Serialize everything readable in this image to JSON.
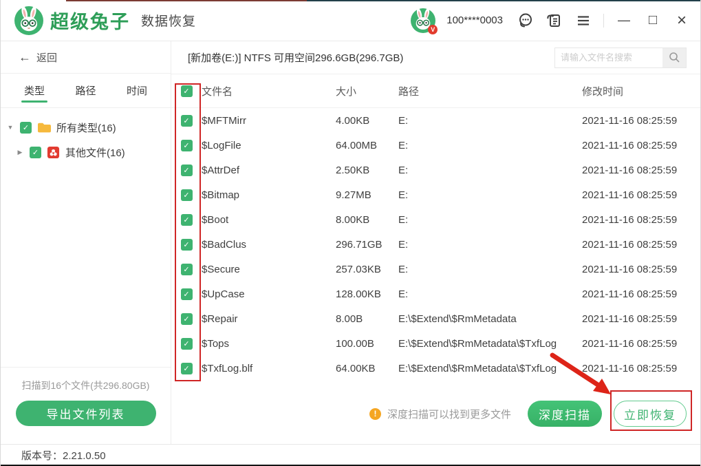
{
  "titlebar": {
    "brand": "超级兔子",
    "product": "数据恢复",
    "account": "100****0003"
  },
  "icons": {
    "back_arrow": "←",
    "caret_down": "▼",
    "caret_right": "▶",
    "check": "✓",
    "warning": "!",
    "minimize": "—",
    "maximize": "□",
    "close": "×",
    "badge_v": "V"
  },
  "sidebar": {
    "back_label": "返回",
    "tabs": [
      {
        "label": "类型",
        "active": true
      },
      {
        "label": "路径",
        "active": false
      },
      {
        "label": "时间",
        "active": false
      }
    ],
    "tree": [
      {
        "label": "所有类型(16)",
        "icon": "folder-icon",
        "checked": true,
        "expanded": true
      },
      {
        "label": "其他文件(16)",
        "icon": "other-file-icon",
        "checked": true,
        "expanded": false
      }
    ],
    "scan_summary": "扫描到16个文件(共296.80GB)",
    "export_button": "导出文件列表"
  },
  "main": {
    "volume_info": "[新加卷(E:)] NTFS 可用空间296.6GB(296.7GB)",
    "search_placeholder": "请输入文件名搜索",
    "table": {
      "columns": [
        "文件名",
        "大小",
        "路径",
        "修改时间"
      ],
      "header_checked": true,
      "rows": [
        {
          "checked": true,
          "name": "$MFTMirr",
          "size": "4.00KB",
          "path": "E:",
          "time": "2021-11-16 08:25:59"
        },
        {
          "checked": true,
          "name": "$LogFile",
          "size": "64.00MB",
          "path": "E:",
          "time": "2021-11-16 08:25:59"
        },
        {
          "checked": true,
          "name": "$AttrDef",
          "size": "2.50KB",
          "path": "E:",
          "time": "2021-11-16 08:25:59"
        },
        {
          "checked": true,
          "name": "$Bitmap",
          "size": "9.27MB",
          "path": "E:",
          "time": "2021-11-16 08:25:59"
        },
        {
          "checked": true,
          "name": "$Boot",
          "size": "8.00KB",
          "path": "E:",
          "time": "2021-11-16 08:25:59"
        },
        {
          "checked": true,
          "name": "$BadClus",
          "size": "296.71GB",
          "path": "E:",
          "time": "2021-11-16 08:25:59"
        },
        {
          "checked": true,
          "name": "$Secure",
          "size": "257.03KB",
          "path": "E:",
          "time": "2021-11-16 08:25:59"
        },
        {
          "checked": true,
          "name": "$UpCase",
          "size": "128.00KB",
          "path": "E:",
          "time": "2021-11-16 08:25:59"
        },
        {
          "checked": true,
          "name": "$Repair",
          "size": "8.00B",
          "path": "E:\\$Extend\\$RmMetadata",
          "time": "2021-11-16 08:25:59"
        },
        {
          "checked": true,
          "name": "$Tops",
          "size": "100.00B",
          "path": "E:\\$Extend\\$RmMetadata\\$TxfLog",
          "time": "2021-11-16 08:25:59"
        },
        {
          "checked": true,
          "name": "$TxfLog.blf",
          "size": "64.00KB",
          "path": "E:\\$Extend\\$RmMetadata\\$TxfLog",
          "time": "2021-11-16 08:25:59"
        }
      ]
    },
    "hint": "深度扫描可以找到更多文件",
    "deep_scan_button": "深度扫描",
    "recover_button": "立即恢复"
  },
  "footer": {
    "version_text": "版本号：2.21.0.50"
  },
  "colors": {
    "brand_green": "#2e9e58",
    "accent_green": "#3eb370",
    "warning_orange": "#f5a623",
    "annotation_red": "#cf2525",
    "badge_red": "#e23c2e"
  }
}
